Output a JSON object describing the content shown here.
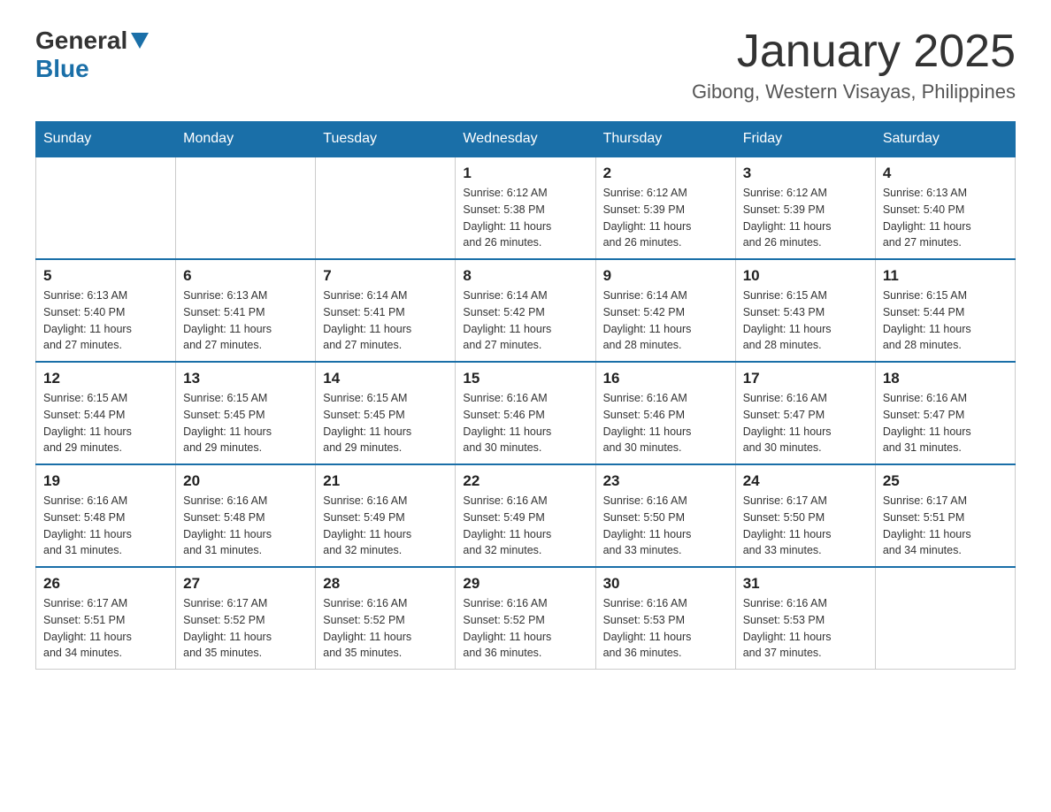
{
  "header": {
    "logo_general": "General",
    "logo_blue": "Blue",
    "month_title": "January 2025",
    "location": "Gibong, Western Visayas, Philippines"
  },
  "days_of_week": [
    "Sunday",
    "Monday",
    "Tuesday",
    "Wednesday",
    "Thursday",
    "Friday",
    "Saturday"
  ],
  "weeks": [
    [
      {
        "day": "",
        "info": ""
      },
      {
        "day": "",
        "info": ""
      },
      {
        "day": "",
        "info": ""
      },
      {
        "day": "1",
        "info": "Sunrise: 6:12 AM\nSunset: 5:38 PM\nDaylight: 11 hours\nand 26 minutes."
      },
      {
        "day": "2",
        "info": "Sunrise: 6:12 AM\nSunset: 5:39 PM\nDaylight: 11 hours\nand 26 minutes."
      },
      {
        "day": "3",
        "info": "Sunrise: 6:12 AM\nSunset: 5:39 PM\nDaylight: 11 hours\nand 26 minutes."
      },
      {
        "day": "4",
        "info": "Sunrise: 6:13 AM\nSunset: 5:40 PM\nDaylight: 11 hours\nand 27 minutes."
      }
    ],
    [
      {
        "day": "5",
        "info": "Sunrise: 6:13 AM\nSunset: 5:40 PM\nDaylight: 11 hours\nand 27 minutes."
      },
      {
        "day": "6",
        "info": "Sunrise: 6:13 AM\nSunset: 5:41 PM\nDaylight: 11 hours\nand 27 minutes."
      },
      {
        "day": "7",
        "info": "Sunrise: 6:14 AM\nSunset: 5:41 PM\nDaylight: 11 hours\nand 27 minutes."
      },
      {
        "day": "8",
        "info": "Sunrise: 6:14 AM\nSunset: 5:42 PM\nDaylight: 11 hours\nand 27 minutes."
      },
      {
        "day": "9",
        "info": "Sunrise: 6:14 AM\nSunset: 5:42 PM\nDaylight: 11 hours\nand 28 minutes."
      },
      {
        "day": "10",
        "info": "Sunrise: 6:15 AM\nSunset: 5:43 PM\nDaylight: 11 hours\nand 28 minutes."
      },
      {
        "day": "11",
        "info": "Sunrise: 6:15 AM\nSunset: 5:44 PM\nDaylight: 11 hours\nand 28 minutes."
      }
    ],
    [
      {
        "day": "12",
        "info": "Sunrise: 6:15 AM\nSunset: 5:44 PM\nDaylight: 11 hours\nand 29 minutes."
      },
      {
        "day": "13",
        "info": "Sunrise: 6:15 AM\nSunset: 5:45 PM\nDaylight: 11 hours\nand 29 minutes."
      },
      {
        "day": "14",
        "info": "Sunrise: 6:15 AM\nSunset: 5:45 PM\nDaylight: 11 hours\nand 29 minutes."
      },
      {
        "day": "15",
        "info": "Sunrise: 6:16 AM\nSunset: 5:46 PM\nDaylight: 11 hours\nand 30 minutes."
      },
      {
        "day": "16",
        "info": "Sunrise: 6:16 AM\nSunset: 5:46 PM\nDaylight: 11 hours\nand 30 minutes."
      },
      {
        "day": "17",
        "info": "Sunrise: 6:16 AM\nSunset: 5:47 PM\nDaylight: 11 hours\nand 30 minutes."
      },
      {
        "day": "18",
        "info": "Sunrise: 6:16 AM\nSunset: 5:47 PM\nDaylight: 11 hours\nand 31 minutes."
      }
    ],
    [
      {
        "day": "19",
        "info": "Sunrise: 6:16 AM\nSunset: 5:48 PM\nDaylight: 11 hours\nand 31 minutes."
      },
      {
        "day": "20",
        "info": "Sunrise: 6:16 AM\nSunset: 5:48 PM\nDaylight: 11 hours\nand 31 minutes."
      },
      {
        "day": "21",
        "info": "Sunrise: 6:16 AM\nSunset: 5:49 PM\nDaylight: 11 hours\nand 32 minutes."
      },
      {
        "day": "22",
        "info": "Sunrise: 6:16 AM\nSunset: 5:49 PM\nDaylight: 11 hours\nand 32 minutes."
      },
      {
        "day": "23",
        "info": "Sunrise: 6:16 AM\nSunset: 5:50 PM\nDaylight: 11 hours\nand 33 minutes."
      },
      {
        "day": "24",
        "info": "Sunrise: 6:17 AM\nSunset: 5:50 PM\nDaylight: 11 hours\nand 33 minutes."
      },
      {
        "day": "25",
        "info": "Sunrise: 6:17 AM\nSunset: 5:51 PM\nDaylight: 11 hours\nand 34 minutes."
      }
    ],
    [
      {
        "day": "26",
        "info": "Sunrise: 6:17 AM\nSunset: 5:51 PM\nDaylight: 11 hours\nand 34 minutes."
      },
      {
        "day": "27",
        "info": "Sunrise: 6:17 AM\nSunset: 5:52 PM\nDaylight: 11 hours\nand 35 minutes."
      },
      {
        "day": "28",
        "info": "Sunrise: 6:16 AM\nSunset: 5:52 PM\nDaylight: 11 hours\nand 35 minutes."
      },
      {
        "day": "29",
        "info": "Sunrise: 6:16 AM\nSunset: 5:52 PM\nDaylight: 11 hours\nand 36 minutes."
      },
      {
        "day": "30",
        "info": "Sunrise: 6:16 AM\nSunset: 5:53 PM\nDaylight: 11 hours\nand 36 minutes."
      },
      {
        "day": "31",
        "info": "Sunrise: 6:16 AM\nSunset: 5:53 PM\nDaylight: 11 hours\nand 37 minutes."
      },
      {
        "day": "",
        "info": ""
      }
    ]
  ]
}
